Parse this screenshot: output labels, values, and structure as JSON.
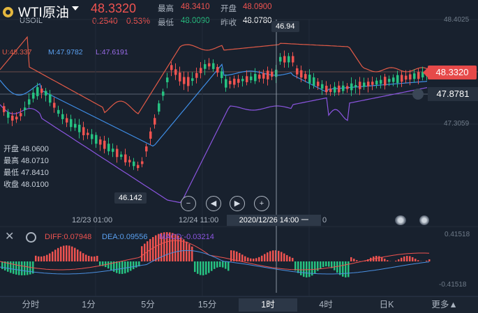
{
  "header": {
    "title": "WTI原油",
    "symbol": "USOIL",
    "price": "48.3320",
    "change": "0.2540",
    "change_pct": "0.53%",
    "high_label": "最高",
    "high_value": "48.3410",
    "open_label": "开盘",
    "open_value": "48.0900",
    "low_label": "最低",
    "low_value": "48.0090",
    "prev_close_label": "昨收",
    "prev_close_value": "48.0780"
  },
  "chart": {
    "boll_u": "U:48.337",
    "boll_m": "M:47.9782",
    "boll_l": "L:47.6191",
    "right_ticks": [
      "48.4025",
      "47.3059"
    ],
    "current_price_tag": "48.3320",
    "line_price_tag": "47.8781",
    "cross_high_label": "46.94",
    "min_label": "46.142",
    "ohlc": {
      "open_label": "开盘",
      "open_value": "48.0600",
      "high_label": "最高",
      "high_value": "48.0710",
      "low_label": "最低",
      "low_value": "47.8410",
      "close_label": "收盘",
      "close_value": "48.0100"
    },
    "x_labels": [
      "12/23 01:00",
      "12/24 11:00",
      "0"
    ],
    "crosshair_time": "2020/12/26 14:00 一",
    "controls": {
      "zoom_out": "−",
      "prev": "◀",
      "next": "▶",
      "zoom_in": "+"
    }
  },
  "macd": {
    "diff": "DIFF:0.07948",
    "dea": "DEA:0.09556",
    "macd": "MACD:-0.03214",
    "top_tick": "0.41518",
    "bottom_tick": "-0.41518"
  },
  "tabs": [
    "分时",
    "1分",
    "5分",
    "15分",
    "1时",
    "4时",
    "日K",
    "更多▲"
  ],
  "selected_tab": "1时",
  "colors": {
    "background": "#18212e",
    "up": "#ef5350",
    "down": "#26c281",
    "boll_upper": "#e05a47",
    "boll_mid": "#3f8fe8",
    "boll_lower": "#8b55e0"
  }
}
